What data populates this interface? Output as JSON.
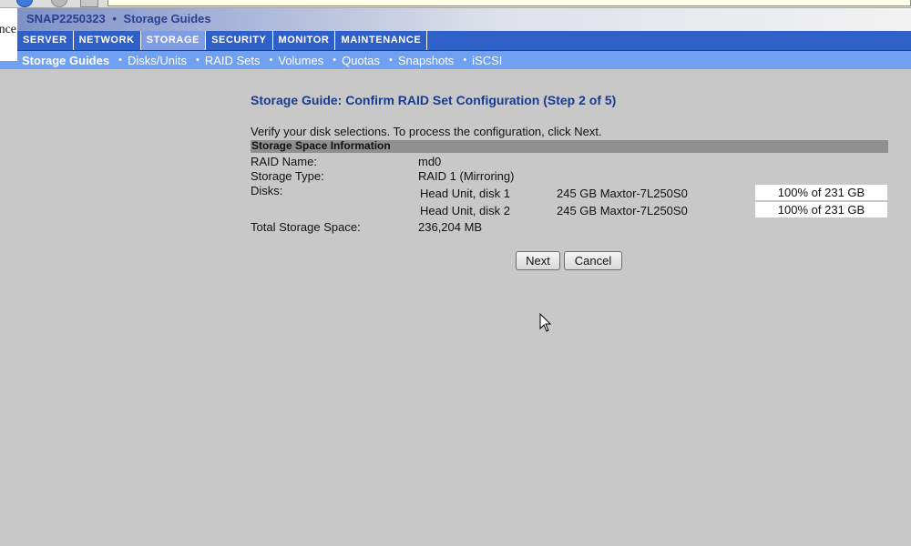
{
  "header": {
    "brand_fragment": "nce",
    "server_name": "SNAP2250323",
    "separator": "•",
    "section": "Storage Guides"
  },
  "main_nav": {
    "tabs": [
      {
        "label": "SERVER",
        "active": false
      },
      {
        "label": "NETWORK",
        "active": false
      },
      {
        "label": "STORAGE",
        "active": true
      },
      {
        "label": "SECURITY",
        "active": false
      },
      {
        "label": "MONITOR",
        "active": false
      },
      {
        "label": "MAINTENANCE",
        "active": false
      }
    ]
  },
  "sub_nav": {
    "bullet": "•",
    "items": [
      {
        "label": "Storage Guides",
        "active": true
      },
      {
        "label": "Disks/Units",
        "active": false
      },
      {
        "label": "RAID Sets",
        "active": false
      },
      {
        "label": "Volumes",
        "active": false
      },
      {
        "label": "Quotas",
        "active": false
      },
      {
        "label": "Snapshots",
        "active": false
      },
      {
        "label": "iSCSI",
        "active": false
      }
    ]
  },
  "content": {
    "title": "Storage Guide: Confirm RAID Set Configuration (Step 2 of 5)",
    "instructions": "Verify your disk selections. To process the configuration, click Next.",
    "section_header": "Storage Space Information",
    "raid_name_label": "RAID Name:",
    "raid_name_value": "md0",
    "storage_type_label": "Storage Type:",
    "storage_type_value": "RAID 1 (Mirroring)",
    "disks_label": "Disks:",
    "disks": [
      {
        "unit": "Head Unit, disk 1",
        "model": "245 GB Maxtor-7L250S0",
        "usage": "100% of 231 GB"
      },
      {
        "unit": "Head Unit, disk 2",
        "model": "245 GB Maxtor-7L250S0",
        "usage": "100% of 231 GB"
      }
    ],
    "total_label": "Total Storage Space:",
    "total_value": "236,204 MB"
  },
  "buttons": {
    "next": "Next",
    "cancel": "Cancel"
  },
  "colors": {
    "nav_bg": "#2f60c8",
    "nav_active": "#7e9de4",
    "subnav_bg": "#6fa0f2",
    "page_bg": "#c8c8c8",
    "title_color": "#1a3a8c"
  }
}
